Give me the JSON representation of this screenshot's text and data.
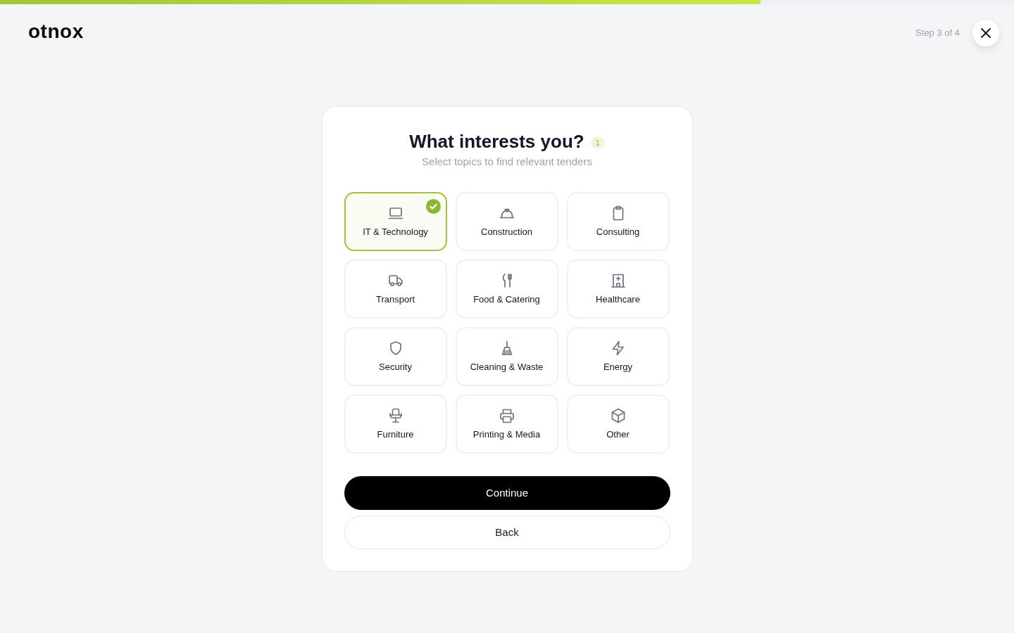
{
  "progress": {
    "level": 0.75
  },
  "header": {
    "logo": "otnox",
    "step": "Step 3 of 4"
  },
  "card": {
    "title": "What interests you?",
    "selected_count": "1",
    "subtitle": "Select topics to find relevant tenders",
    "topics": [
      {
        "label": "IT & Technology",
        "selected": true
      },
      {
        "label": "Construction",
        "selected": false
      },
      {
        "label": "Consulting",
        "selected": false
      },
      {
        "label": "Transport",
        "selected": false
      },
      {
        "label": "Food & Catering",
        "selected": false
      },
      {
        "label": "Healthcare",
        "selected": false
      },
      {
        "label": "Security",
        "selected": false
      },
      {
        "label": "Cleaning & Waste",
        "selected": false
      },
      {
        "label": "Energy",
        "selected": false
      },
      {
        "label": "Furniture",
        "selected": false
      },
      {
        "label": "Printing & Media",
        "selected": false
      },
      {
        "label": "Other",
        "selected": false
      }
    ],
    "buttons": [
      {
        "label": "Continue",
        "kind": "primary"
      },
      {
        "label": "Back",
        "kind": "secondary"
      }
    ]
  }
}
